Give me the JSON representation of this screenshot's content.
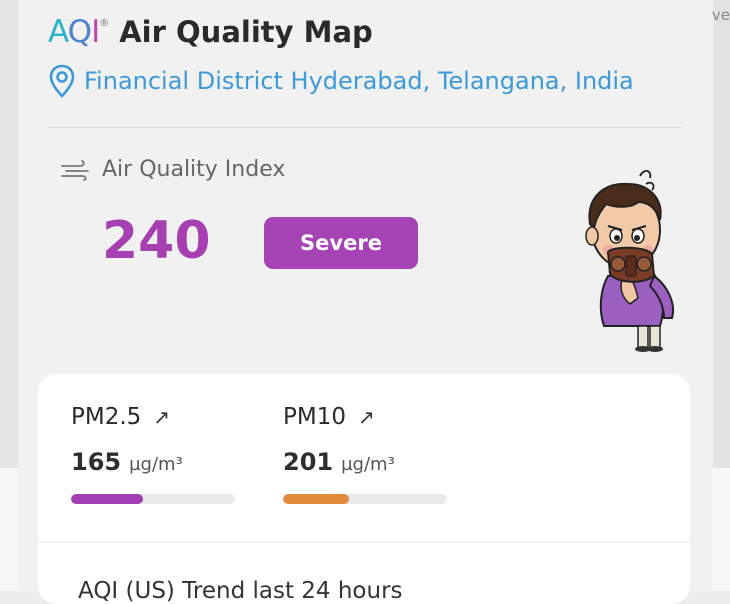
{
  "map_edge_text": "ve",
  "brand": {
    "logo_a": "A",
    "logo_q": "Q",
    "logo_i": "I",
    "logo_sup": "®",
    "title": "Air Quality Map"
  },
  "location": {
    "icon": "location-pin-icon",
    "text": "Financial District Hyderabad, Telangana, India"
  },
  "aqi": {
    "icon": "wind-icon",
    "label": "Air Quality Index",
    "value": "240",
    "status": "Severe",
    "status_color": "#a644b5",
    "value_color": "#a63fb0"
  },
  "pollutants": [
    {
      "name": "PM2.5",
      "trend_icon": "arrow-up-right-icon",
      "trend_glyph": "↗",
      "value": "165",
      "unit": "µg/m³",
      "level": 0.44,
      "color": "#a23db3"
    },
    {
      "name": "PM10",
      "trend_icon": "arrow-up-right-icon",
      "trend_glyph": "↗",
      "value": "201",
      "unit": "µg/m³",
      "level": 0.4,
      "color": "#e08a3c"
    }
  ],
  "trend": {
    "title": "AQI (US) Trend last 24 hours"
  }
}
